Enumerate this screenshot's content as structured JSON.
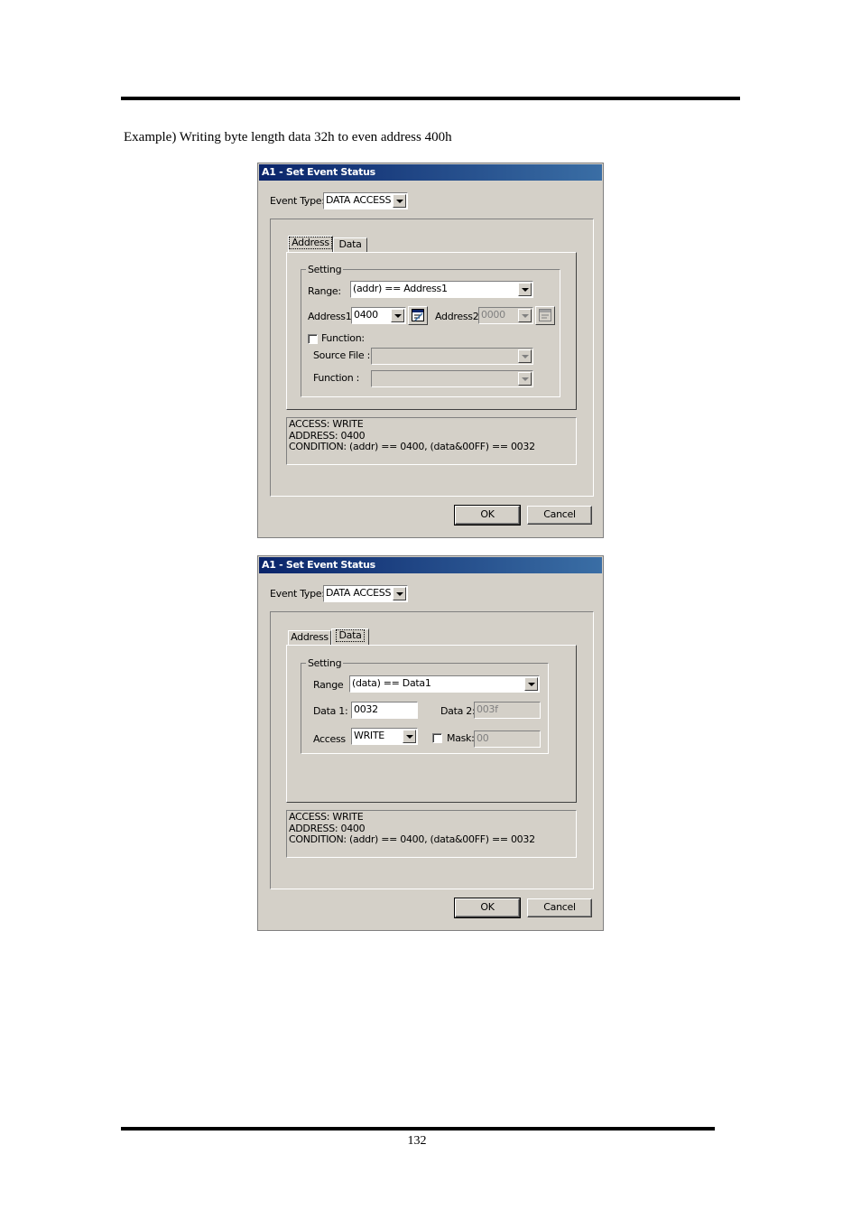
{
  "document": {
    "caption": "Example) Writing byte length data 32h to even address 400h",
    "page_number": "132"
  },
  "dialog1": {
    "title": "A1 - Set Event Status",
    "event_type_label": "Event Type:",
    "event_type_value": "DATA ACCESS",
    "tabs": [
      "Address",
      "Data"
    ],
    "active_tab": "Address",
    "group_title": "Setting",
    "range_label": "Range:",
    "range_value": "(addr) == Address1",
    "address1_label": "Address1:",
    "address1_value": "0400",
    "address2_label": "Address2:",
    "address2_value": "0000",
    "function_check_label": "Function:",
    "function_checked": false,
    "source_file_label": "Source File :",
    "source_file_value": "",
    "function_label": "Function :",
    "function_value": "",
    "summary": {
      "line1": "ACCESS: WRITE",
      "line2": "ADDRESS: 0400",
      "line3": "CONDITION: (addr) == 0400, (data&00FF) == 0032"
    },
    "ok_label": "OK",
    "cancel_label": "Cancel"
  },
  "dialog2": {
    "title": "A1 - Set Event Status",
    "event_type_label": "Event Type:",
    "event_type_value": "DATA ACCESS",
    "tabs": [
      "Address",
      "Data"
    ],
    "active_tab": "Data",
    "group_title": "Setting",
    "range_label": "Range",
    "range_value": "(data) == Data1",
    "data1_label": "Data 1:",
    "data1_value": "0032",
    "data2_label": "Data 2:",
    "data2_value": "003f",
    "access_label": "Access",
    "access_value": "WRITE",
    "mask_label": "Mask:",
    "mask_checked": false,
    "mask_value": "00",
    "summary": {
      "line1": "ACCESS: WRITE",
      "line2": "ADDRESS: 0400",
      "line3": "CONDITION: (addr) == 0400, (data&00FF) == 0032"
    },
    "ok_label": "OK",
    "cancel_label": "Cancel"
  },
  "colors": {
    "dialog_face": "#d4d0c8",
    "titlebar_start": "#0a246a",
    "titlebar_end": "#3a6ea5",
    "disabled_text": "#808080"
  }
}
